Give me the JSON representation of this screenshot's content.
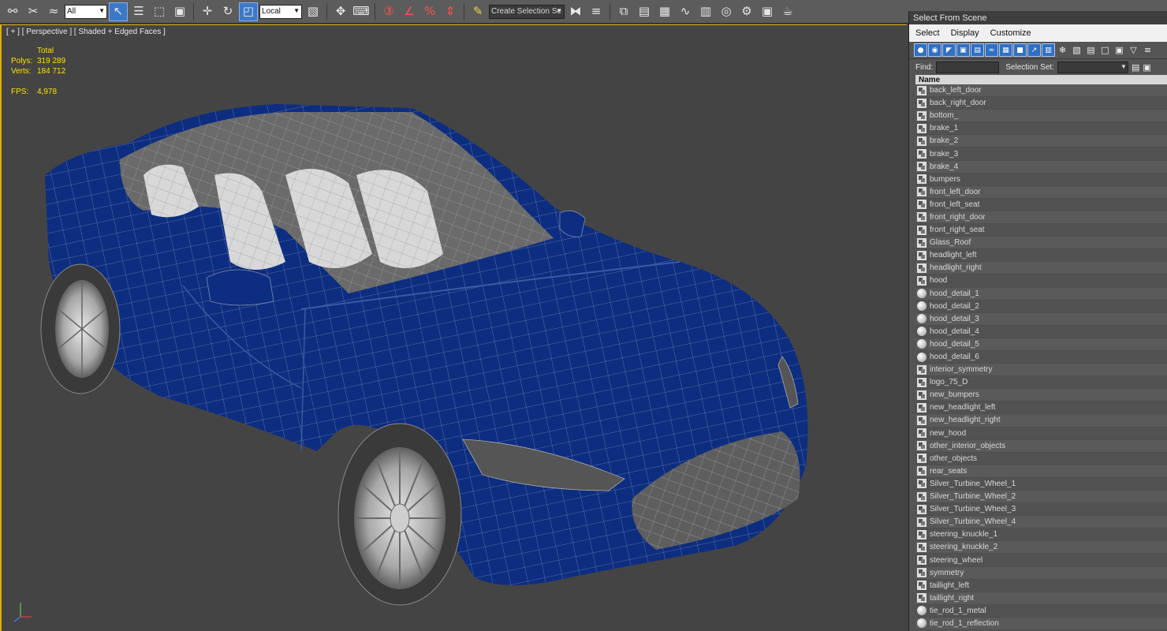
{
  "toolbar": {
    "filter_value": "All",
    "coord_value": "Local",
    "selection_set_placeholder": "Create Selection Se",
    "icons": [
      "link-icon",
      "unlink-icon",
      "bind-space-warp-icon",
      "select-object-icon",
      "select-by-name-icon",
      "rect-region-icon",
      "window-crossing-icon",
      "move-icon",
      "rotate-icon",
      "scale-icon",
      "pivot-icon",
      "select-manipulate-icon",
      "keyboard-shortcut-icon",
      "snap-3-icon",
      "angle-snap-icon",
      "percent-snap-icon",
      "spinner-snap-icon",
      "edit-named-sel-icon",
      "mirror-icon",
      "align-icon",
      "layer-manager-icon",
      "scene-explorer-icon",
      "ribbon-icon",
      "curve-editor-icon",
      "schematic-view-icon",
      "material-editor-icon",
      "render-setup-icon",
      "render-frame-icon",
      "render-icon"
    ]
  },
  "viewport": {
    "label": "[ + ] [ Perspective ] [ Shaded + Edged Faces ]",
    "stats": {
      "total_label": "Total",
      "polys_label": "Polys:",
      "polys_value": "319 289",
      "verts_label": "Verts:",
      "verts_value": "184 712",
      "fps_label": "FPS:",
      "fps_value": "4,978"
    },
    "colors": {
      "body": "#0d2d80",
      "wire": "#8a9ab8",
      "interior": "#d8d8d8",
      "background": "#444444",
      "active_border": "#e0b000"
    }
  },
  "panel": {
    "title": "Select From Scene",
    "menu": [
      "Select",
      "Display",
      "Customize"
    ],
    "find_label": "Find:",
    "selection_set_label": "Selection Set:",
    "column_header": "Name",
    "items": [
      {
        "name": "back_left_door",
        "icon": "group"
      },
      {
        "name": "back_right_door",
        "icon": "group"
      },
      {
        "name": "bottom_",
        "icon": "group"
      },
      {
        "name": "brake_1",
        "icon": "group"
      },
      {
        "name": "brake_2",
        "icon": "group"
      },
      {
        "name": "brake_3",
        "icon": "group"
      },
      {
        "name": "brake_4",
        "icon": "group"
      },
      {
        "name": "bumpers",
        "icon": "group"
      },
      {
        "name": "front_left_door",
        "icon": "group"
      },
      {
        "name": "front_left_seat",
        "icon": "group"
      },
      {
        "name": "front_right_door",
        "icon": "group"
      },
      {
        "name": "front_right_seat",
        "icon": "group"
      },
      {
        "name": "Glass_Roof",
        "icon": "group"
      },
      {
        "name": "headlight_left",
        "icon": "group"
      },
      {
        "name": "headlight_right",
        "icon": "group"
      },
      {
        "name": "hood",
        "icon": "group"
      },
      {
        "name": "hood_detail_1",
        "icon": "sphere"
      },
      {
        "name": "hood_detail_2",
        "icon": "sphere"
      },
      {
        "name": "hood_detail_3",
        "icon": "sphere"
      },
      {
        "name": "hood_detail_4",
        "icon": "sphere"
      },
      {
        "name": "hood_detail_5",
        "icon": "sphere"
      },
      {
        "name": "hood_detail_6",
        "icon": "sphere"
      },
      {
        "name": "interior_symmetry",
        "icon": "group"
      },
      {
        "name": "logo_75_D",
        "icon": "group"
      },
      {
        "name": "new_bumpers",
        "icon": "group"
      },
      {
        "name": "new_headlight_left",
        "icon": "group"
      },
      {
        "name": "new_headlight_right",
        "icon": "group"
      },
      {
        "name": "new_hood",
        "icon": "group"
      },
      {
        "name": "other_interior_objects",
        "icon": "group"
      },
      {
        "name": "other_objects",
        "icon": "group"
      },
      {
        "name": "rear_seats",
        "icon": "group"
      },
      {
        "name": "Silver_Turbine_Wheel_1",
        "icon": "group"
      },
      {
        "name": "Silver_Turbine_Wheel_2",
        "icon": "group"
      },
      {
        "name": "Silver_Turbine_Wheel_3",
        "icon": "group"
      },
      {
        "name": "Silver_Turbine_Wheel_4",
        "icon": "group"
      },
      {
        "name": "steering_knuckle_1",
        "icon": "group"
      },
      {
        "name": "steering_knuckle_2",
        "icon": "group"
      },
      {
        "name": "steering_wheel",
        "icon": "group"
      },
      {
        "name": "symmetry",
        "icon": "group"
      },
      {
        "name": "taillight_left",
        "icon": "group"
      },
      {
        "name": "taillight_right",
        "icon": "group"
      },
      {
        "name": "tie_rod_1_metal",
        "icon": "sphere"
      },
      {
        "name": "tie_rod_1_reflection",
        "icon": "sphere"
      }
    ]
  }
}
